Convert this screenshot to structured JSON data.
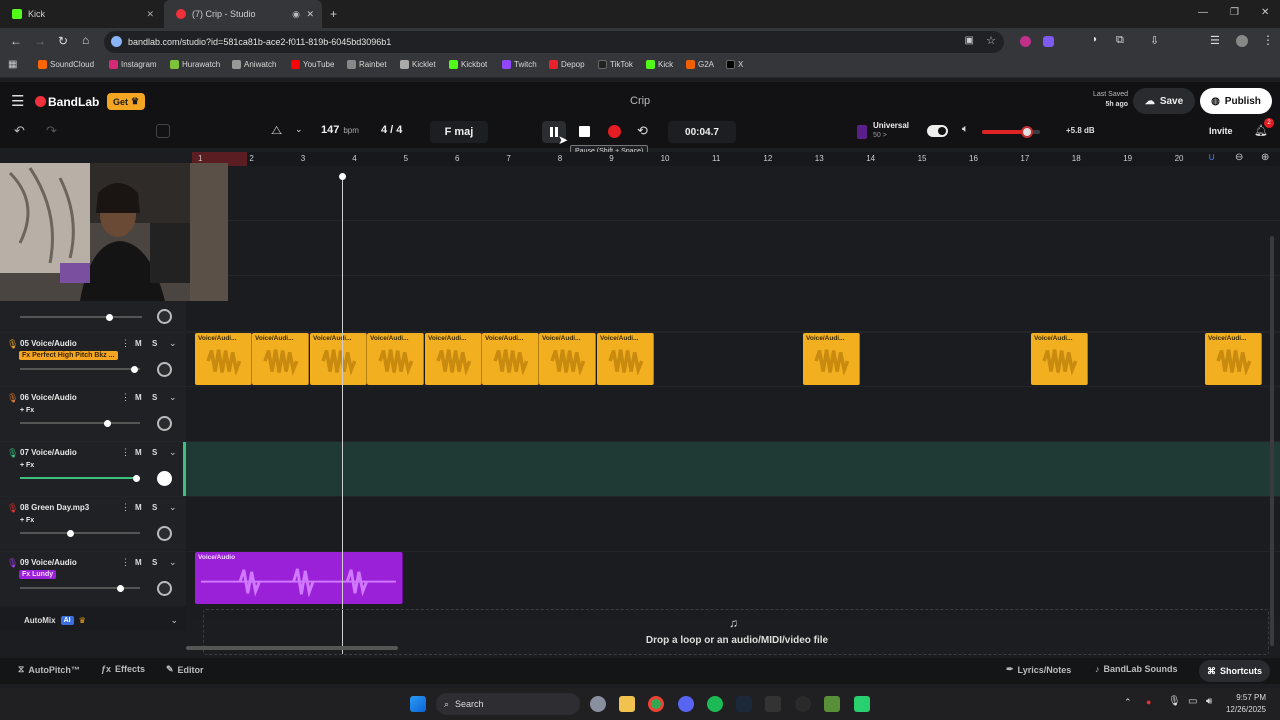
{
  "browser": {
    "tabs": [
      {
        "label": "Kick"
      },
      {
        "label": "(7) Crip - Studio"
      }
    ],
    "url": "bandlab.com/studio?id=581ca81b-ace2-f011-819b-6045bd3096b1",
    "bookmarks": [
      "SoundCloud",
      "Instagram",
      "Hurawatch",
      "Aniwatch",
      "YouTube",
      "Rainbet",
      "Kicklet",
      "Kickbot",
      "Twitch",
      "Depop",
      "TikTok",
      "Kick",
      "G2A",
      "X"
    ]
  },
  "app": {
    "brand": "BandLab",
    "get_label": "Get",
    "project_title": "Crip",
    "last_saved_label": "Last Saved",
    "last_saved_time": "5h ago",
    "save_label": "Save",
    "publish_label": "Publish",
    "invite_label": "Invite",
    "notification_count": "2"
  },
  "toolbar": {
    "bpm_value": "147",
    "bpm_unit": "bpm",
    "time_signature": "4 / 4",
    "key": "F maj",
    "time": "00:04.7",
    "tooltip": "Pause (Shift + Space)",
    "preset_name": "Universal",
    "preset_sub": "50 >",
    "volume_db": "+5.8 dB",
    "volume_level": 0.78
  },
  "ruler": {
    "bars": [
      "1",
      "2",
      "3",
      "4",
      "5",
      "6",
      "7",
      "8",
      "9",
      "10",
      "11",
      "12",
      "13",
      "14",
      "15",
      "16",
      "17",
      "18",
      "19",
      "20"
    ]
  },
  "tracks": [
    {
      "id": "05",
      "name": "Voice/Audio",
      "fx": "Fx Perfect High Pitch Bkz ...",
      "fx_style": "pill-yellow",
      "color": "#e8a020",
      "level": 0.95,
      "clip_label": "Voice/Audio",
      "clip_label_short": "Voice/Audi..."
    },
    {
      "id": "06",
      "name": "Voice/Audio",
      "fx": "+ Fx",
      "fx_style": "plain",
      "color": "#e07b30",
      "level": 0.73
    },
    {
      "id": "07",
      "name": "Voice/Audio",
      "fx": "+ Fx",
      "fx_style": "plain",
      "color": "#3fbf7f",
      "level": 0.97
    },
    {
      "id": "08",
      "name": "Green Day.mp3",
      "fx": "+ Fx",
      "fx_style": "plain",
      "color": "#e03030",
      "level": 0.42
    },
    {
      "id": "09",
      "name": "Voice/Audio",
      "fx": "Fx Lundy",
      "fx_style": "pill-purple",
      "color": "#a040e0",
      "level": 0.84,
      "clip_label": "Voice/Audio"
    }
  ],
  "track_labels": {
    "mute": "M",
    "solo": "S",
    "pan_l": "L",
    "pan_r": "R"
  },
  "automix": {
    "label": "AutoMix",
    "badge": "AI"
  },
  "drop_zone": {
    "text": "Drop a loop or an audio/MIDI/video file"
  },
  "bottom": {
    "autopitch": "AutoPitch™",
    "effects": "Effects",
    "editor": "Editor",
    "lyrics": "Lyrics/Notes",
    "sounds": "BandLab Sounds",
    "shortcuts": "Shortcuts"
  },
  "taskbar": {
    "search": "Search",
    "time": "9:57 PM",
    "date": "12/26/2025"
  }
}
